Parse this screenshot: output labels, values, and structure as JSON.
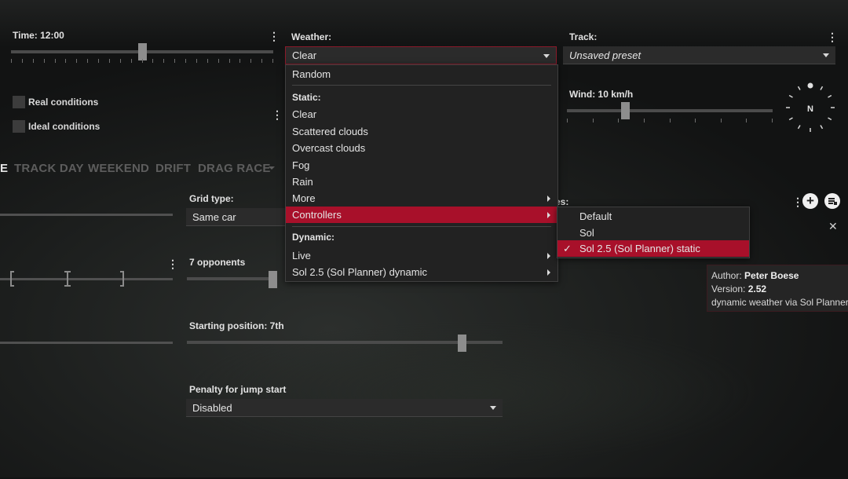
{
  "time": {
    "label": "Time: 12:00",
    "value_fraction": 0.5
  },
  "weather": {
    "label": "Weather:",
    "selected": "Clear"
  },
  "track": {
    "label": "Track:",
    "selected": "Unsaved preset"
  },
  "conditions": {
    "real": "Real conditions",
    "ideal": "Ideal conditions"
  },
  "wind": {
    "label": "Wind: 10 km/h",
    "direction": "N"
  },
  "tabs": [
    "E",
    "TRACK DAY",
    "WEEKEND",
    "DRIFT",
    "DRAG RACE"
  ],
  "grid": {
    "label": "Grid type:",
    "selected": "Same car"
  },
  "opponents": {
    "label": "7 opponents"
  },
  "starting": {
    "label": "Starting position: 7th"
  },
  "penalty": {
    "label": "Penalty for jump start",
    "selected": "Disabled"
  },
  "right_section_label_fragment": "es:",
  "weather_menu": {
    "random": "Random",
    "static_header": "Static:",
    "static_items": [
      "Clear",
      "Scattered clouds",
      "Overcast clouds",
      "Fog",
      "Rain"
    ],
    "more": "More",
    "controllers": "Controllers",
    "dynamic_header": "Dynamic:",
    "dynamic_items": [
      "Live",
      "Sol 2.5 (Sol Planner) dynamic"
    ]
  },
  "controllers_menu": {
    "items": [
      "Default",
      "Sol",
      "Sol 2.5 (Sol Planner) static"
    ],
    "checked_index": 2
  },
  "tooltip": {
    "author_label": "Author:",
    "author": "Peter Boese",
    "version_label": "Version:",
    "version": "2.52",
    "description": "dynamic weather via Sol Planner"
  },
  "icons": {
    "menu": "vertical-dots-icon",
    "add": "plus-icon",
    "list": "list-icon",
    "close": "close-icon",
    "check": "checkmark-icon",
    "compass": "compass-icon"
  },
  "colors": {
    "accent": "#a8102a",
    "panel": "#2b2b2b"
  }
}
